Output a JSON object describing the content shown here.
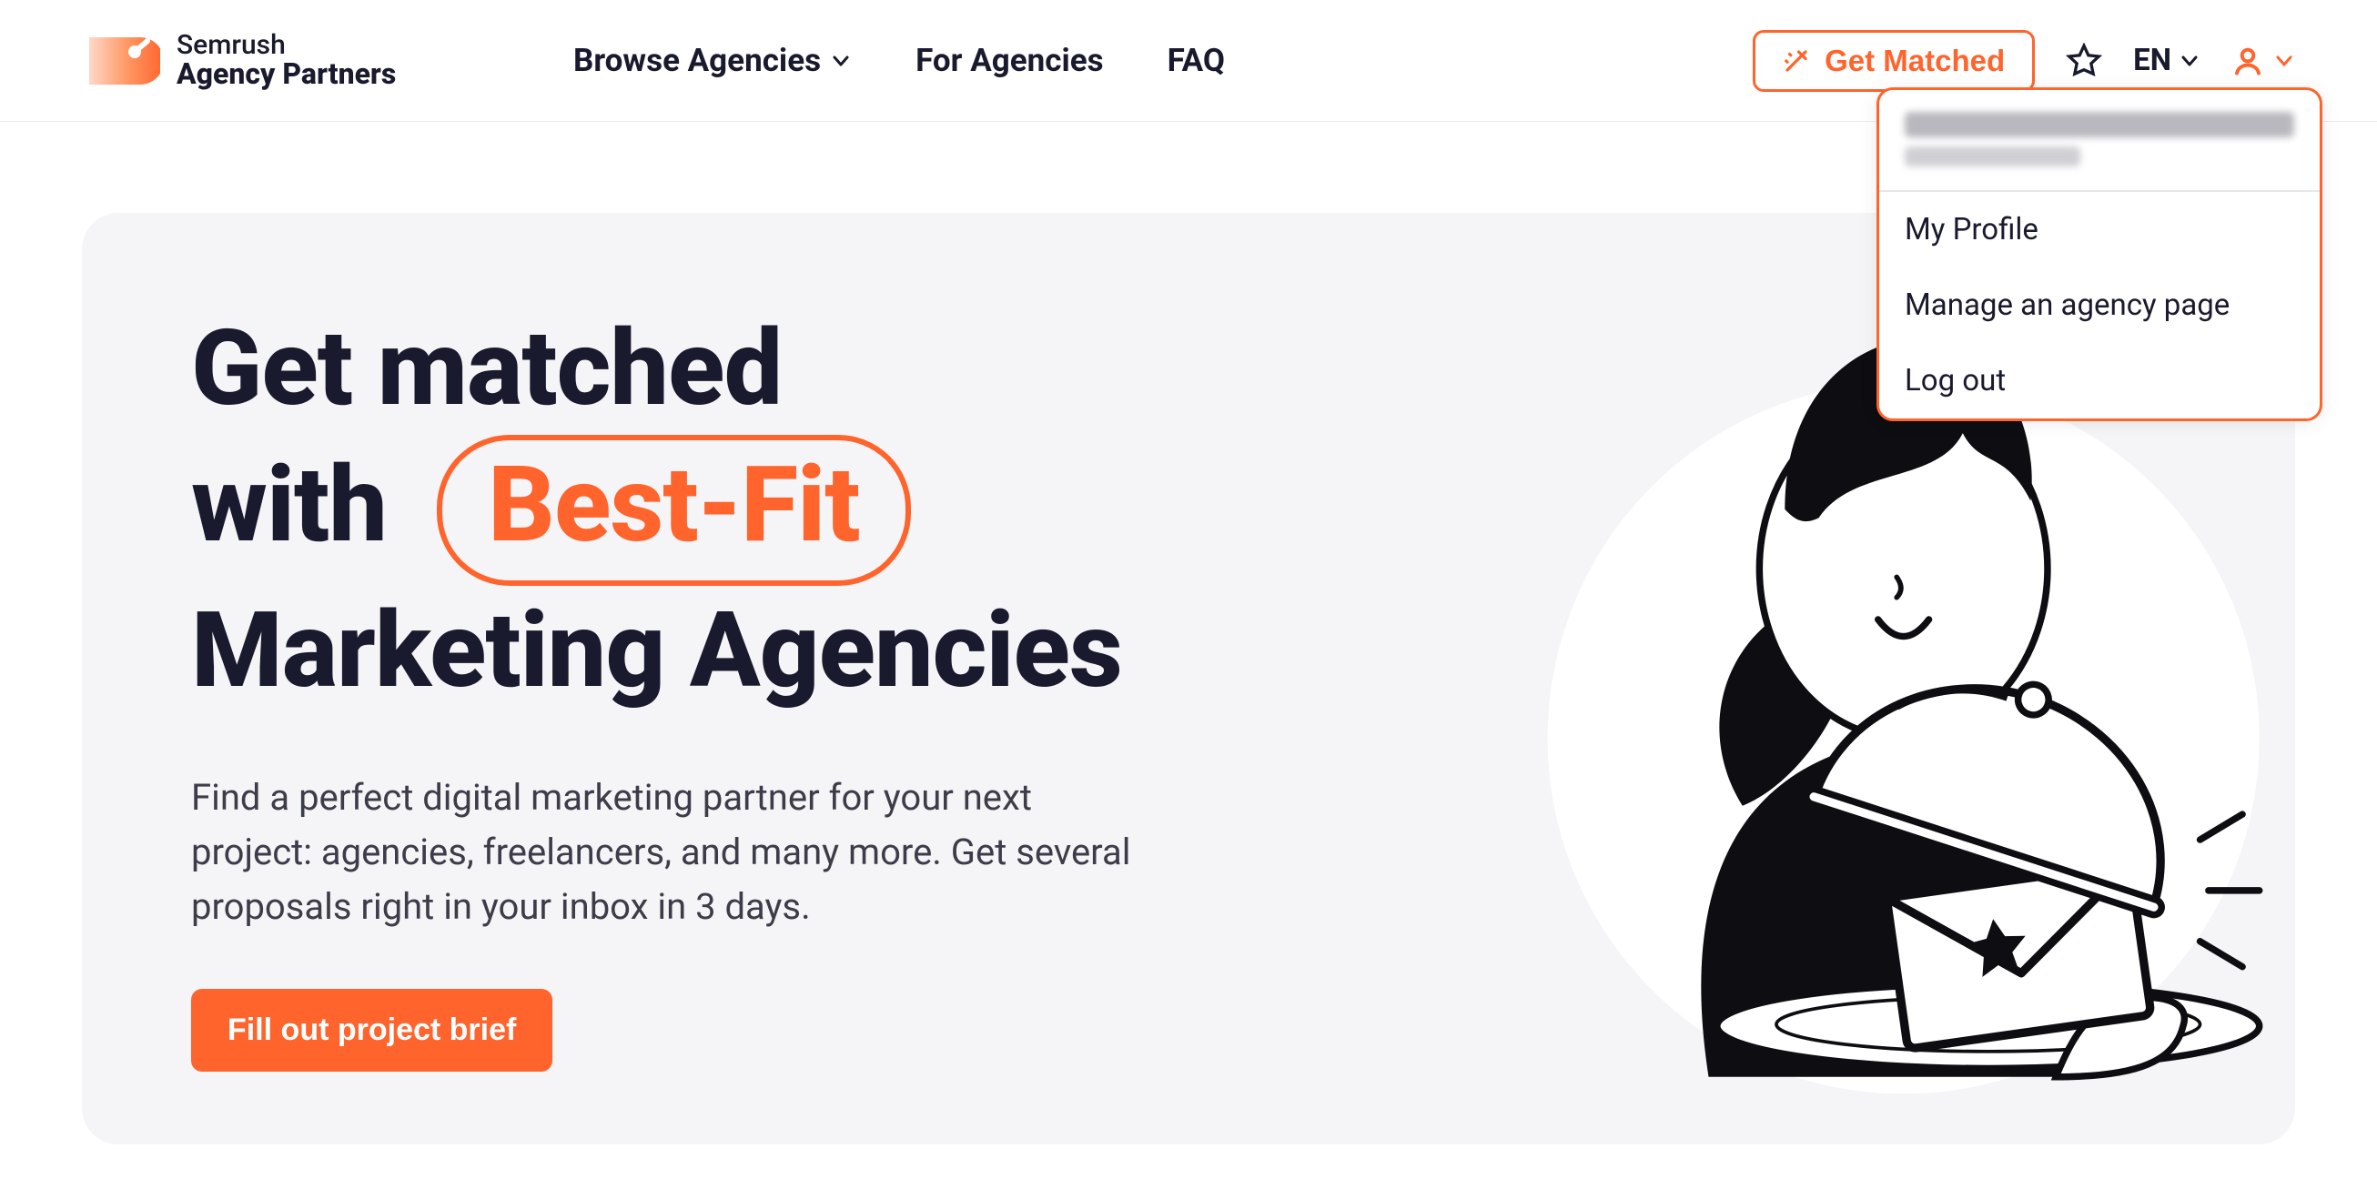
{
  "logo": {
    "line1": "Semrush",
    "line2": "Agency Partners"
  },
  "nav": {
    "browse": "Browse Agencies",
    "for_agencies": "For Agencies",
    "faq": "FAQ"
  },
  "header": {
    "get_matched": "Get Matched",
    "lang": "EN"
  },
  "dropdown": {
    "items": [
      "My Profile",
      "Manage an agency page",
      "Log out"
    ]
  },
  "hero": {
    "title_l1": "Get matched",
    "title_l2_prefix": "with",
    "title_highlight": "Best-Fit",
    "title_l3": "Marketing Agencies",
    "subtitle": "Find a perfect digital marketing partner for your next project: agencies, freelancers, and many more. Get several proposals right in your inbox in 3 days.",
    "cta": "Fill out project brief"
  },
  "colors": {
    "accent": "#ff642d"
  }
}
